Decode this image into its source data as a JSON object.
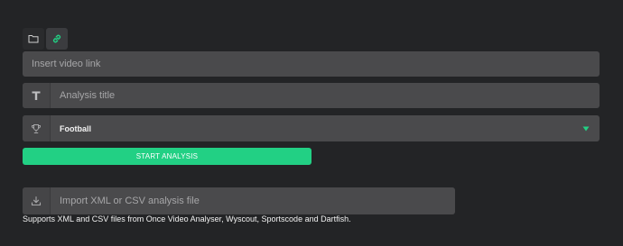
{
  "source_tabs": {
    "folder": {
      "icon": "folder-icon"
    },
    "link": {
      "icon": "link-icon",
      "active": true
    }
  },
  "link_input": {
    "placeholder": "Insert video link"
  },
  "title_input": {
    "placeholder": "Analysis title",
    "icon": "text-t-icon"
  },
  "sport_select": {
    "value": "Football",
    "icon": "trophy-icon",
    "caret_icon": "triangle-down-icon"
  },
  "start_button": {
    "label": "START ANALYSIS"
  },
  "import_input": {
    "placeholder": "Import XML or CSV analysis file",
    "icon": "download-icon"
  },
  "support_note": "Supports XML and CSV files from Once Video Analyser, Wyscout, Sportscode and Dartfish.",
  "colors": {
    "accent": "#22d084",
    "background": "#232426",
    "field": "#4a4a4c"
  }
}
